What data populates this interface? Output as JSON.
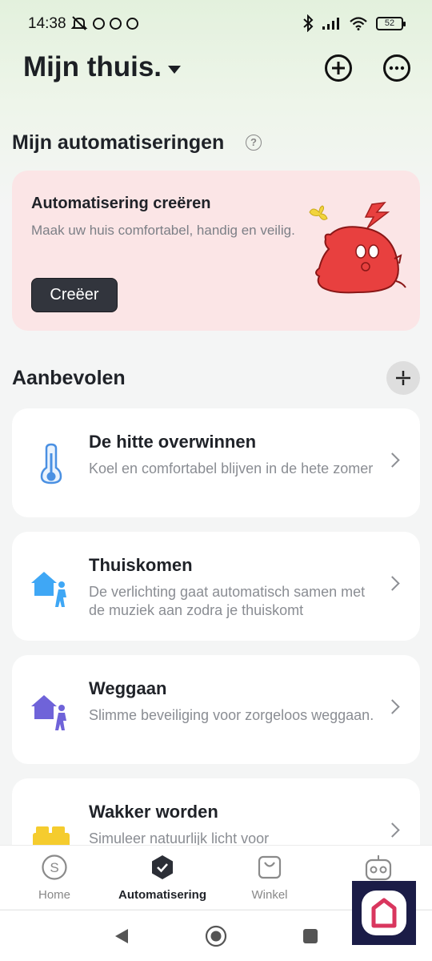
{
  "status_bar": {
    "time": "14:38",
    "battery": "52"
  },
  "header": {
    "home_title": "Mijn thuis."
  },
  "automations": {
    "title": "Mijn automatiseringen",
    "help_symbol": "?",
    "create_card": {
      "title": "Automatisering creëren",
      "description": "Maak uw huis comfortabel, handig en veilig.",
      "button": "Creëer"
    }
  },
  "recommended": {
    "title": "Aanbevolen",
    "items": [
      {
        "title": "De hitte overwinnen",
        "description": "Koel en comfortabel blijven in de hete zomer",
        "icon": "thermometer-icon"
      },
      {
        "title": "Thuiskomen",
        "description": "De verlichting gaat automatisch samen met de muziek aan zodra je thuiskomt",
        "icon": "home-arrive-icon"
      },
      {
        "title": "Weggaan",
        "description": "Slimme beveiliging voor zorgeloos weggaan.",
        "icon": "home-leave-icon"
      },
      {
        "title": "Wakker worden",
        "description": "Simuleer natuurlijk licht voor",
        "icon": "bed-icon"
      }
    ]
  },
  "bottom_nav": {
    "items": [
      {
        "label": "Home",
        "icon": "home-s-icon",
        "active": false
      },
      {
        "label": "Automatisering",
        "icon": "automation-check-icon",
        "active": true
      },
      {
        "label": "Winkel",
        "icon": "shop-bag-icon",
        "active": false
      }
    ]
  },
  "colors": {
    "accent_dark": "#32353d",
    "create_card_bg": "#fbe5e6",
    "mascot_red": "#e8403f",
    "thermometer_blue": "#4a90e2",
    "arrive_blue": "#3fa7f5",
    "leave_purple": "#6f63d9",
    "bed_yellow": "#f5cc2e"
  }
}
